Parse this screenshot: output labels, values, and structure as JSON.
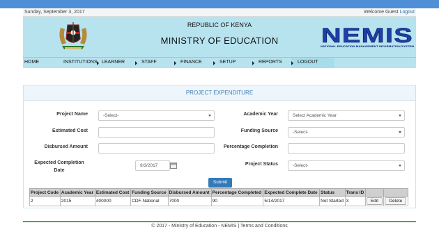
{
  "topbar": {
    "date": "Sunday, September 3, 2017",
    "welcome": "Welcome Guest",
    "logout": "Logout"
  },
  "header": {
    "republic": "REPUBLIC OF KENYA",
    "ministry": "MINISTRY OF EDUCATION",
    "logo_text": "NEMIS",
    "logo_sub": "NATIONAL EDUCATION MANAGEMENT INFORMATION SYSTEM"
  },
  "nav": {
    "items": [
      "HOME",
      "INSTITUTIONS",
      "LEARNER",
      "STAFF",
      "FINANCE",
      "SETUP",
      "REPORTS",
      "LOGOUT"
    ]
  },
  "panel": {
    "title": "PROJECT EXPENDITURE",
    "project_name_label": "Project Name",
    "project_name_value": "-Select-",
    "academic_year_label": "Academic Year",
    "academic_year_value": "Select Academic Year",
    "estimated_cost_label": "Estimated Cost",
    "estimated_cost_value": "",
    "funding_source_label": "Funding Source",
    "funding_source_value": "-Select-",
    "disbursed_amount_label": "Disbursed Amount",
    "disbursed_amount_value": "",
    "percentage_completion_label": "Percentage Completion",
    "percentage_completion_value": "",
    "expected_completion_label_1": "Expected Completion",
    "expected_completion_label_2": "Date",
    "expected_completion_value": "9/3/2017",
    "project_status_label": "Project Status",
    "project_status_value": "-Select-",
    "submit": "Submit"
  },
  "table": {
    "headers": [
      "Project Code",
      "Academic Year",
      "Estimated Cost",
      "Funding Source",
      "Disbursed Amount",
      "Percentage Completed",
      "Expected Complete Date",
      "Status",
      "Trans ID",
      "",
      ""
    ],
    "rows": [
      {
        "project_code": "2",
        "academic_year": "2015",
        "estimated_cost": "400000",
        "funding_source": "CDF-National",
        "disbursed_amount": "7000",
        "percentage_completed": "90",
        "expected_complete_date": "5/14/2017",
        "status": "Not Started",
        "trans_id": "3",
        "edit": "Edit",
        "delete": "Delete"
      }
    ]
  },
  "footer": {
    "text": "© 2017 - Ministry of Education - NEMIS | Terms and Conditions"
  },
  "colors": {
    "header_bg": "#b7e3ef",
    "top_strip": "#4f8fd8",
    "accent": "#337ab7",
    "nemis_blue": "#1f3fa8",
    "footer_line": "#4caa4c"
  }
}
